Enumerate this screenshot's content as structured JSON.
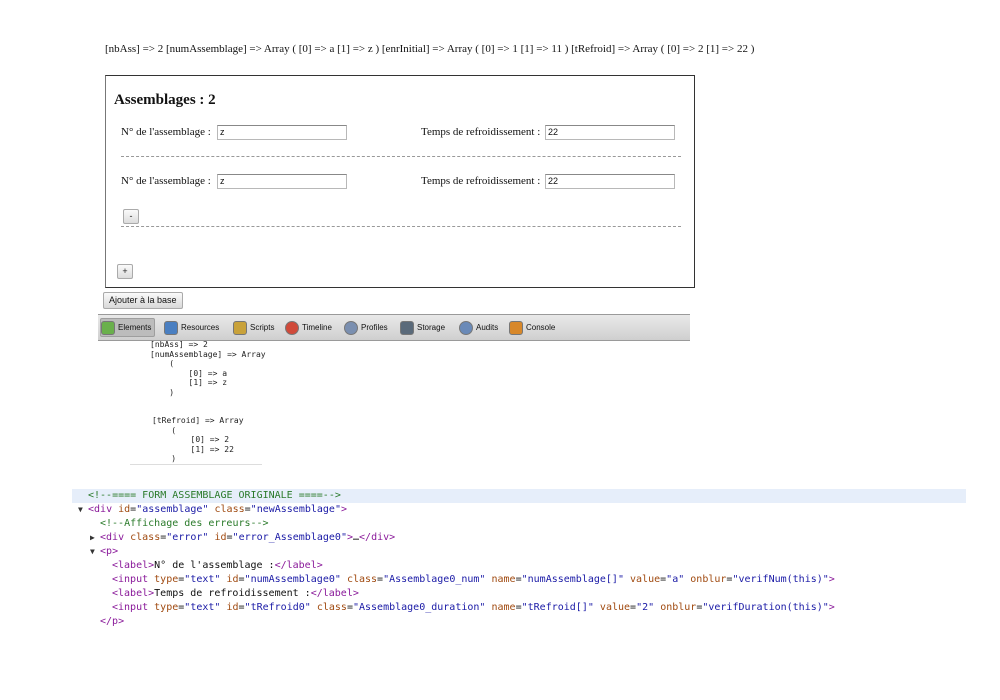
{
  "top_dump": "[nbAss] => 2 [numAssemblage] => Array ( [0] => a [1] => z ) [enrInitial] => Array ( [0] => 1 [1] => 11 ) [tRefroid] => Array ( [0] => 2 [1] => 22 )",
  "form": {
    "title": "Assemblages : 2",
    "rows": [
      {
        "num_label": "N° de l'assemblage :",
        "num_value": "z",
        "time_label": "Temps de refroidissement :",
        "time_value": "22"
      },
      {
        "num_label": "N° de l'assemblage :",
        "num_value": "z",
        "time_label": "Temps de refroidissement :",
        "time_value": "22"
      }
    ],
    "remove_button": "-",
    "add_button": "+",
    "submit_button": "Ajouter à la base"
  },
  "devtools": {
    "tabs": [
      "Elements",
      "Resources",
      "Scripts",
      "Timeline",
      "Profiles",
      "Storage",
      "Audits",
      "Console"
    ],
    "active_tab": "Elements",
    "icon_names": [
      "elements-icon",
      "resources-icon",
      "scripts-icon",
      "timeline-icon",
      "profiles-icon",
      "storage-icon",
      "audits-icon",
      "console-icon"
    ],
    "icon_colors": [
      "#6ab04c",
      "#4a7fc1",
      "#c9a23a",
      "#d04a3a",
      "#7a8fb0",
      "#5a6a7a",
      "#6a8ab8",
      "#d8882a"
    ]
  },
  "print_r": [
    "[nbAss] => 2",
    "[numAssemblage] => Array",
    "    (",
    "        [0] => a",
    "        [1] => z",
    "    )",
    "",
    "",
    "[tRefroid] => Array",
    "    (",
    "        [0] => 2",
    "        [1] => 22",
    "    )"
  ],
  "source": {
    "comment_form": "<!--==== FORM ASSEMBLAGE ORIGINALE ====-->",
    "div_open": {
      "tag": "div",
      "id": "assemblage",
      "class": "newAssemblage"
    },
    "comment_errors": "<!--Affichage des erreurs-->",
    "div_error": {
      "tag": "div",
      "class": "error",
      "id": "error_Assemblage0",
      "ellipsis": "…"
    },
    "p_tag": "p",
    "label1_text": "N° de l'assemblage :",
    "input1": {
      "type": "text",
      "id": "numAssemblage0",
      "class": "Assemblage0_num",
      "name": "numAssemblage[]",
      "value": "a",
      "onblur": "verifNum(this)"
    },
    "label2_text": "Temps de refroidissement :",
    "input2": {
      "type": "text",
      "id": "tRefroid0",
      "class": "Assemblage0_duration",
      "name": "tRefroid[]",
      "value": "2",
      "onblur": "verifDuration(this)"
    }
  }
}
